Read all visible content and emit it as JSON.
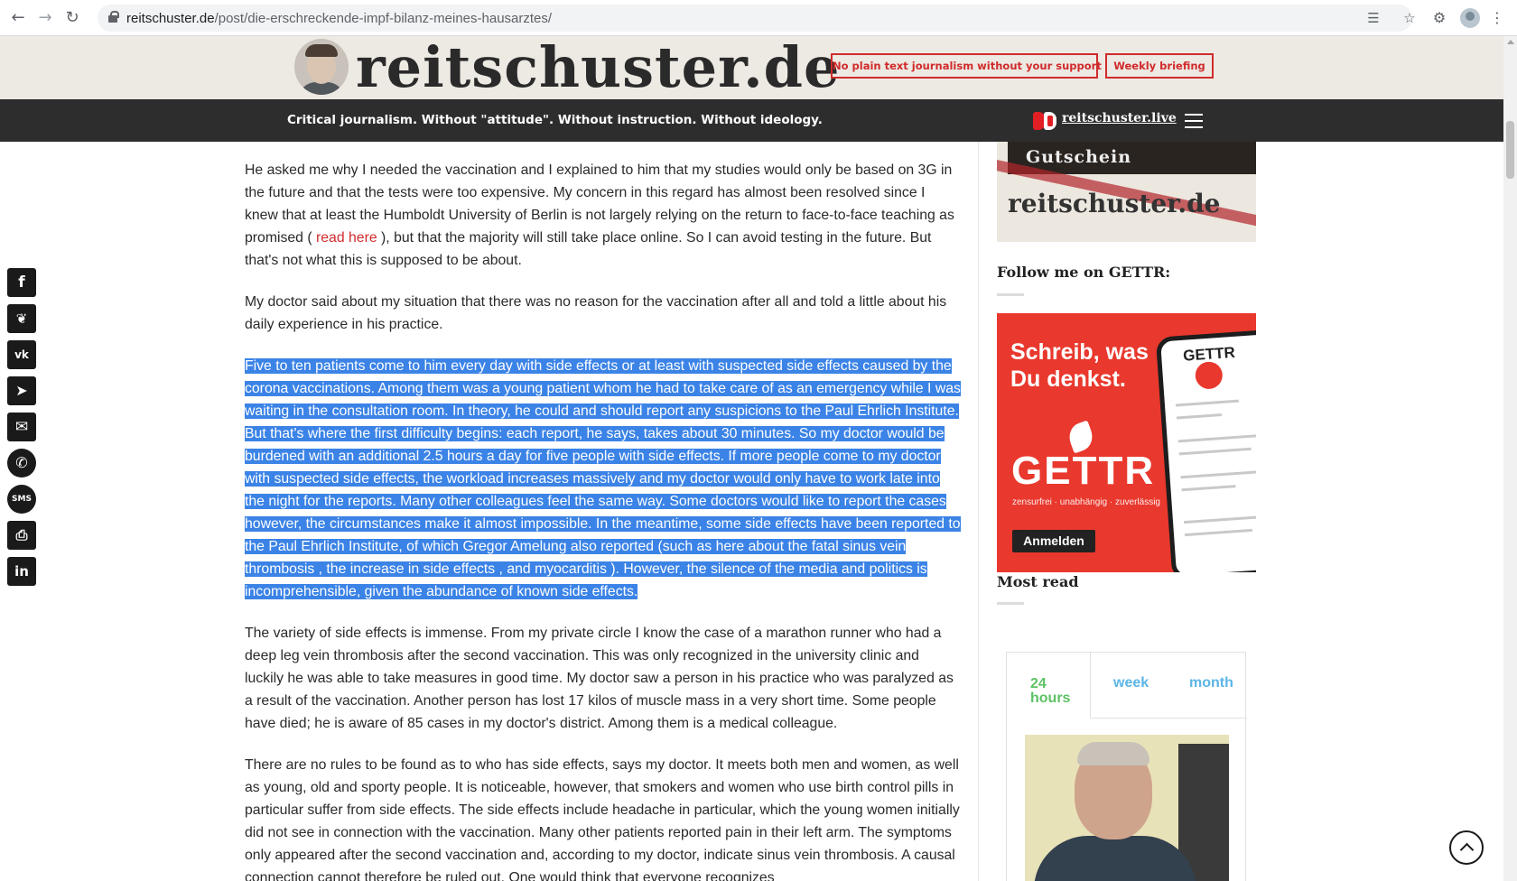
{
  "browser": {
    "url_domain": "reitschuster.de",
    "url_path": "/post/die-erschreckende-impf-bilanz-meines-hausarztes/"
  },
  "site": {
    "brand": "reitschuster.de",
    "support_button": "No plain text journalism without your support",
    "briefing_button": "Weekly briefing",
    "tagline": "Critical journalism. Without \"attitude\". Without instruction. Without ideology.",
    "live_link": "reitschuster.live"
  },
  "article": {
    "p1_before": "He asked me why I needed the vaccination and I explained to him that my studies would only be based on 3G in the future and that the tests were too expensive. My concern in this regard has almost been resolved since I knew that at least the Humboldt University of Berlin is not largely relying on the return to face-to-face teaching as promised ( ",
    "p1_link": "read here",
    "p1_after": " ), but that the majority will still take place online. So I can avoid testing in the future. But that's not what this is supposed to be about.",
    "p2": "My doctor said about my situation that there was no reason for the vaccination after all and told a little about his daily experience in his practice.",
    "p3": "Five to ten patients come to him every day with side effects or at least with suspected side effects caused by the corona vaccinations. Among them was a young patient whom he had to take care of as an emergency while I was waiting in the consultation room. In theory, he could and should report any suspicions to the Paul Ehrlich Institute. But that's where the first difficulty begins: each report, he says, takes about 30 minutes. So my doctor would be burdened with an additional 2.5 hours a day for five people with side effects. If more people come to my doctor with suspected side effects, the workload increases massively and my doctor would only have to work late into the night for the reports. Many other colleagues feel the same way. Some doctors would like to report the cases however, the circumstances make it almost impossible. In the meantime, some side effects have been reported to the Paul Ehrlich Institute, of which Gregor Amelung also reported (such as here about the fatal sinus vein thrombosis , the increase in side effects , and myocarditis ). However, the silence of the media and politics is incomprehensible, given the abundance of known side effects.",
    "p4": "The variety of side effects is immense. From my private circle I know the case of a marathon runner who had a deep leg vein thrombosis after the second vaccination. This was only recognized in the university clinic and luckily he was able to take measures in good time. My doctor saw a person in his practice who was paralyzed as a result of the vaccination. Another person has lost 17 kilos of muscle mass in a very short time. Some people have died; he is aware of 85 cases in my doctor's district. Among them is a medical colleague.",
    "p5": "There are no rules to be found as to who has side effects, says my doctor. It meets both men and women, as well as young, old and sporty people. It is noticeable, however, that smokers and women who use birth control pills in particular suffer from side effects. The side effects include headache in particular, which the young women initially did not see in connection with the vaccination. Many other patients reported pain in their left arm. The symptoms only appeared after the second vaccination and, according to my doctor, indicate sinus vein thrombosis. A causal connection cannot therefore be ruled out. One would think that everyone recognizes"
  },
  "sidebar": {
    "voucher_text": "Gutschein",
    "voucher_brand": "reitschuster.de",
    "follow_heading": "Follow me on GETTR:",
    "gettr_slogan_1": "Schreib, was",
    "gettr_slogan_2": "Du denkst.",
    "gettr_name": "GETTR",
    "gettr_sub": "zensurfrei · unabhängig · zuverlässig",
    "gettr_button": "Anmelden",
    "phone_brand": "GETTR",
    "most_read_heading": "Most read",
    "tabs": [
      "24 hours",
      "week",
      "month"
    ]
  },
  "share_icons": [
    "facebook-icon",
    "twitter-icon",
    "vk-icon",
    "telegram-icon",
    "email-icon",
    "whatsapp-icon",
    "sms-icon",
    "print-icon",
    "linkedin-icon"
  ],
  "colors": {
    "accent_red": "#d02b2b",
    "selection": "#3b83e6",
    "tab_active": "#5cc265",
    "tab_inactive": "#5bb5e6"
  }
}
